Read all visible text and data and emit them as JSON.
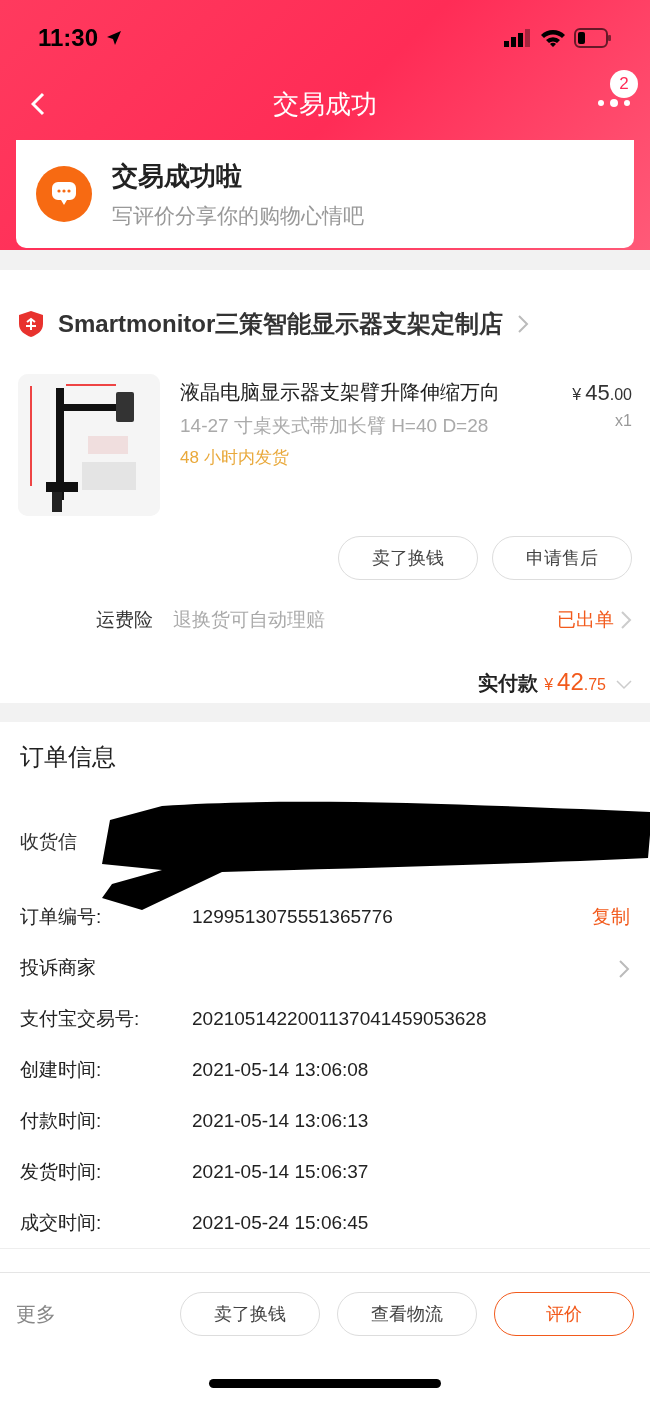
{
  "status_bar": {
    "time": "11:30"
  },
  "nav": {
    "title": "交易成功",
    "badge": "2"
  },
  "banner": {
    "title": "交易成功啦",
    "subtitle": "写评价分享你的购物心情吧"
  },
  "store": {
    "name": "Smartmonitor三策智能显示器支架定制店"
  },
  "product": {
    "title": "液晶电脑显示器支架臂升降伸缩万向",
    "spec": "14-27 寸桌夹式带加长臂 H=40 D=28",
    "shipping": "48 小时内发货",
    "price_symbol": "¥",
    "price_int": "45",
    "price_dec": ".00",
    "quantity": "x1"
  },
  "item_buttons": [
    "卖了换钱",
    "申请售后"
  ],
  "insurance": {
    "label": "运费险",
    "desc": "退换货可自动理赔",
    "status": "已出单"
  },
  "paid": {
    "label": "实付款",
    "symbol": "¥",
    "int": "42",
    "dec": ".75"
  },
  "order_info": {
    "title": "订单信息",
    "receiver_label": "收货信",
    "rows": [
      {
        "kind": "copy",
        "label": "订单编号:",
        "value": "1299513075551365776",
        "action": "复制"
      },
      {
        "kind": "link",
        "label": "投诉商家"
      },
      {
        "kind": "plain",
        "label": "支付宝交易号:",
        "value": "2021051422001137041459053628"
      },
      {
        "kind": "plain",
        "label": "创建时间:",
        "value": "2021-05-14 13:06:08"
      },
      {
        "kind": "plain",
        "label": "付款时间:",
        "value": "2021-05-14 13:06:13"
      },
      {
        "kind": "plain",
        "label": "发货时间:",
        "value": "2021-05-14 15:06:37"
      },
      {
        "kind": "plain",
        "label": "成交时间:",
        "value": "2021-05-24 15:06:45"
      }
    ]
  },
  "bottom_bar": {
    "more": "更多",
    "buttons": [
      {
        "label": "卖了换钱",
        "primary": false
      },
      {
        "label": "查看物流",
        "primary": false
      },
      {
        "label": "评价",
        "primary": true
      }
    ]
  }
}
